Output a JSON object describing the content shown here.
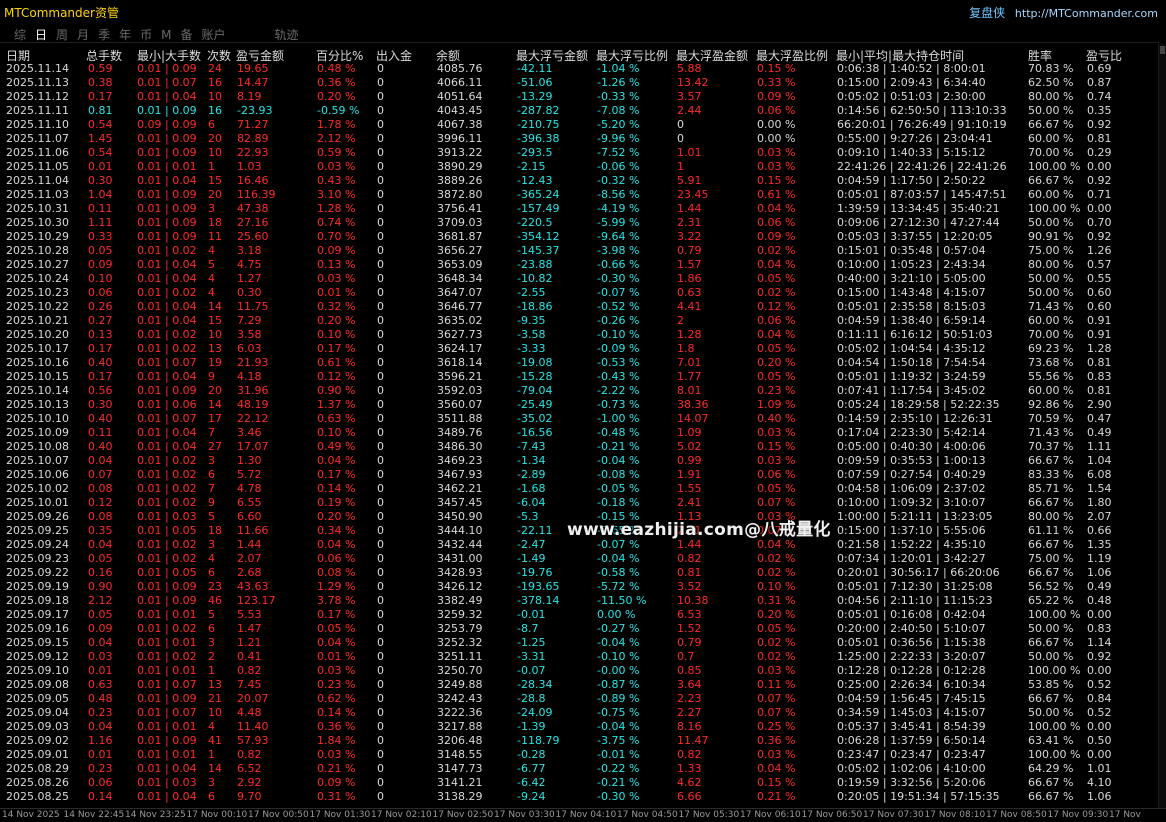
{
  "app": {
    "title": "MTCommander资管",
    "copy_label": "复盘侠",
    "url": "http://MTCommander.com"
  },
  "tabs": [
    "综",
    "日",
    "周",
    "月",
    "季",
    "年",
    "币",
    "M",
    "备",
    "账户",
    "轨迹"
  ],
  "active_tab": "日",
  "headers": {
    "date": "日期",
    "total_lots": "总手数",
    "lot_range": "最小|大手数",
    "count": "次数",
    "pnl": "盈亏金额",
    "pct": "百分比%",
    "deposit": "出入金",
    "balance": "余额",
    "max_float_loss": "最大浮亏金额",
    "max_float_loss_pct": "最大浮亏比例",
    "max_float_profit": "最大浮盈金额",
    "max_float_profit_pct": "最大浮盈比例",
    "hold_time": "最小|平均|最大持仓时间",
    "win_rate": "胜率",
    "pl_ratio": "盈亏比"
  },
  "rows": [
    [
      "2025.11.14",
      "0.59",
      "0.01 | 0.09",
      "24",
      "19.65",
      "0.48 %",
      "0",
      "4085.76",
      "-42.11",
      "-1.04 %",
      "5.88",
      "0.15 %",
      "0:06:38 | 1:40:52 | 8:00:01",
      "70.83 %",
      "0.69"
    ],
    [
      "2025.11.13",
      "0.38",
      "0.01 | 0.07",
      "16",
      "14.47",
      "0.36 %",
      "0",
      "4066.11",
      "-51.06",
      "-1.26 %",
      "13.42",
      "0.33 %",
      "0:15:00 | 2:09:43 | 6:34:40",
      "62.50 %",
      "0.87"
    ],
    [
      "2025.11.12",
      "0.17",
      "0.01 | 0.04",
      "10",
      "8.19",
      "0.20 %",
      "0",
      "4051.64",
      "-13.29",
      "-0.33 %",
      "3.57",
      "0.09 %",
      "0:05:02 | 0:51:03 | 2:30:00",
      "80.00 %",
      "0.74"
    ],
    [
      "2025.11.11",
      "0.81",
      "0.01 | 0.09",
      "16",
      "-23.93",
      "-0.59 %",
      "0",
      "4043.45",
      "-287.82",
      "-7.08 %",
      "2.44",
      "0.06 %",
      "0:14:56 | 62:50:50 | 113:10:33",
      "50.00 %",
      "0.35"
    ],
    [
      "2025.11.10",
      "0.54",
      "0.09 | 0.09",
      "6",
      "71.27",
      "1.78 %",
      "0",
      "4067.38",
      "-210.75",
      "-5.20 %",
      "0",
      "0.00 %",
      "66:20:01 | 76:26:49 | 91:10:19",
      "66.67 %",
      "0.92"
    ],
    [
      "2025.11.07",
      "1.45",
      "0.01 | 0.09",
      "20",
      "82.89",
      "2.12 %",
      "0",
      "3996.11",
      "-396.38",
      "-9.96 %",
      "0",
      "0.00 %",
      "0:55:00 | 9:27:26 | 23:04:41",
      "60.00 %",
      "0.81"
    ],
    [
      "2025.11.06",
      "0.54",
      "0.01 | 0.09",
      "10",
      "22.93",
      "0.59 %",
      "0",
      "3913.22",
      "-293.5",
      "-7.52 %",
      "1.01",
      "0.03 %",
      "0:09:10 | 1:40:33 | 5:15:12",
      "70.00 %",
      "0.29"
    ],
    [
      "2025.11.05",
      "0.01",
      "0.01 | 0.01",
      "1",
      "1.03",
      "0.03 %",
      "0",
      "3890.29",
      "-2.15",
      "-0.06 %",
      "1",
      "0.03 %",
      "22:41:26 | 22:41:26 | 22:41:26",
      "100.00 %",
      "0.00"
    ],
    [
      "2025.11.04",
      "0.30",
      "0.01 | 0.04",
      "15",
      "16.46",
      "0.43 %",
      "0",
      "3889.26",
      "-12.43",
      "-0.32 %",
      "5.91",
      "0.15 %",
      "0:04:59 | 1:17:50 | 2:50:22",
      "66.67 %",
      "0.92"
    ],
    [
      "2025.11.03",
      "1.04",
      "0.01 | 0.09",
      "20",
      "116.39",
      "3.10 %",
      "0",
      "3872.80",
      "-365.24",
      "-8.56 %",
      "23.45",
      "0.61 %",
      "0:05:01 | 87:03:57 | 145:47:51",
      "60.00 %",
      "0.71"
    ],
    [
      "2025.10.31",
      "0.11",
      "0.01 | 0.09",
      "3",
      "47.38",
      "1.28 %",
      "0",
      "3756.41",
      "-157.49",
      "-4.19 %",
      "1.44",
      "0.04 %",
      "1:39:59 | 13:34:45 | 35:40:21",
      "100.00 %",
      "0.00"
    ],
    [
      "2025.10.30",
      "1.11",
      "0.01 | 0.09",
      "18",
      "27.16",
      "0.74 %",
      "0",
      "3709.03",
      "-220.5",
      "-5.99 %",
      "2.31",
      "0.06 %",
      "0:09:06 | 27:12:30 | 47:27:44",
      "50.00 %",
      "0.70"
    ],
    [
      "2025.10.29",
      "0.33",
      "0.01 | 0.09",
      "11",
      "25.60",
      "0.70 %",
      "0",
      "3681.87",
      "-354.12",
      "-9.64 %",
      "3.22",
      "0.09 %",
      "0:05:03 | 3:37:55 | 12:20:05",
      "90.91 %",
      "0.92"
    ],
    [
      "2025.10.28",
      "0.05",
      "0.01 | 0.02",
      "4",
      "3.18",
      "0.09 %",
      "0",
      "3656.27",
      "-145.37",
      "-3.98 %",
      "0.79",
      "0.02 %",
      "0:15:01 | 0:35:48 | 0:57:04",
      "75.00 %",
      "1.26"
    ],
    [
      "2025.10.27",
      "0.09",
      "0.01 | 0.04",
      "5",
      "4.75",
      "0.13 %",
      "0",
      "3653.09",
      "-23.88",
      "-0.66 %",
      "1.57",
      "0.04 %",
      "0:10:00 | 1:05:23 | 2:43:34",
      "80.00 %",
      "0.57"
    ],
    [
      "2025.10.24",
      "0.10",
      "0.01 | 0.04",
      "4",
      "1.27",
      "0.03 %",
      "0",
      "3648.34",
      "-10.82",
      "-0.30 %",
      "1.86",
      "0.05 %",
      "0:40:00 | 3:21:10 | 5:05:00",
      "50.00 %",
      "0.55"
    ],
    [
      "2025.10.23",
      "0.06",
      "0.01 | 0.02",
      "4",
      "0.30",
      "0.01 %",
      "0",
      "3647.07",
      "-2.55",
      "-0.07 %",
      "0.63",
      "0.02 %",
      "0:15:00 | 1:43:48 | 4:15:07",
      "50.00 %",
      "0.60"
    ],
    [
      "2025.10.22",
      "0.26",
      "0.01 | 0.04",
      "14",
      "11.75",
      "0.32 %",
      "0",
      "3646.77",
      "-18.86",
      "-0.52 %",
      "4.41",
      "0.12 %",
      "0:05:01 | 2:35:58 | 8:15:03",
      "71.43 %",
      "0.60"
    ],
    [
      "2025.10.21",
      "0.27",
      "0.01 | 0.04",
      "15",
      "7.29",
      "0.20 %",
      "0",
      "3635.02",
      "-9.35",
      "-0.26 %",
      "2",
      "0.06 %",
      "0:04:59 | 1:38:40 | 6:59:14",
      "60.00 %",
      "0.91"
    ],
    [
      "2025.10.20",
      "0.13",
      "0.01 | 0.02",
      "10",
      "3.58",
      "0.10 %",
      "0",
      "3627.73",
      "-3.58",
      "-0.10 %",
      "1.28",
      "0.04 %",
      "0:11:11 | 6:16:12 | 50:51:03",
      "70.00 %",
      "0.91"
    ],
    [
      "2025.10.17",
      "0.17",
      "0.01 | 0.02",
      "13",
      "6.03",
      "0.17 %",
      "0",
      "3624.17",
      "-3.33",
      "-0.09 %",
      "1.8",
      "0.05 %",
      "0:05:02 | 1:04:54 | 4:35:12",
      "69.23 %",
      "1.28"
    ],
    [
      "2025.10.16",
      "0.40",
      "0.01 | 0.07",
      "19",
      "21.93",
      "0.61 %",
      "0",
      "3618.14",
      "-19.08",
      "-0.53 %",
      "7.01",
      "0.20 %",
      "0:04:54 | 1:50:18 | 7:54:54",
      "73.68 %",
      "0.81"
    ],
    [
      "2025.10.15",
      "0.17",
      "0.01 | 0.04",
      "9",
      "4.18",
      "0.12 %",
      "0",
      "3596.21",
      "-15.28",
      "-0.43 %",
      "1.77",
      "0.05 %",
      "0:05:01 | 1:19:32 | 3:24:59",
      "55.56 %",
      "0.83"
    ],
    [
      "2025.10.14",
      "0.56",
      "0.01 | 0.09",
      "20",
      "31.96",
      "0.90 %",
      "0",
      "3592.03",
      "-79.04",
      "-2.22 %",
      "8.01",
      "0.23 %",
      "0:07:41 | 1:17:54 | 3:45:02",
      "60.00 %",
      "0.81"
    ],
    [
      "2025.10.13",
      "0.30",
      "0.01 | 0.06",
      "14",
      "48.19",
      "1.37 %",
      "0",
      "3560.07",
      "-25.49",
      "-0.73 %",
      "38.36",
      "1.09 %",
      "0:05:24 | 18:29:58 | 52:22:35",
      "92.86 %",
      "2.90"
    ],
    [
      "2025.10.10",
      "0.40",
      "0.01 | 0.07",
      "17",
      "22.12",
      "0.63 %",
      "0",
      "3511.88",
      "-35.02",
      "-1.00 %",
      "14.07",
      "0.40 %",
      "0:14:59 | 2:35:10 | 12:26:31",
      "70.59 %",
      "0.47"
    ],
    [
      "2025.10.09",
      "0.11",
      "0.01 | 0.04",
      "7",
      "3.46",
      "0.10 %",
      "0",
      "3489.76",
      "-16.56",
      "-0.48 %",
      "1.09",
      "0.03 %",
      "0:17:04 | 2:23:30 | 5:42:14",
      "71.43 %",
      "0.49"
    ],
    [
      "2025.10.08",
      "0.40",
      "0.01 | 0.04",
      "27",
      "17.07",
      "0.49 %",
      "0",
      "3486.30",
      "-7.43",
      "-0.21 %",
      "5.02",
      "0.15 %",
      "0:05:00 | 0:40:30 | 4:00:06",
      "70.37 %",
      "1.11"
    ],
    [
      "2025.10.07",
      "0.04",
      "0.01 | 0.02",
      "3",
      "1.30",
      "0.04 %",
      "0",
      "3469.23",
      "-1.34",
      "-0.04 %",
      "0.99",
      "0.03 %",
      "0:09:59 | 0:35:53 | 1:00:13",
      "66.67 %",
      "1.04"
    ],
    [
      "2025.10.06",
      "0.07",
      "0.01 | 0.02",
      "6",
      "5.72",
      "0.17 %",
      "0",
      "3467.93",
      "-2.89",
      "-0.08 %",
      "1.91",
      "0.06 %",
      "0:07:59 | 0:27:54 | 0:40:29",
      "83.33 %",
      "6.08"
    ],
    [
      "2025.10.02",
      "0.08",
      "0.01 | 0.02",
      "7",
      "4.78",
      "0.14 %",
      "0",
      "3462.21",
      "-1.68",
      "-0.05 %",
      "1.55",
      "0.05 %",
      "0:04:58 | 1:06:09 | 2:37:02",
      "85.71 %",
      "1.54"
    ],
    [
      "2025.10.01",
      "0.12",
      "0.01 | 0.02",
      "9",
      "6.55",
      "0.19 %",
      "0",
      "3457.45",
      "-6.04",
      "-0.18 %",
      "2.41",
      "0.07 %",
      "0:10:00 | 1:09:32 | 3:10:07",
      "66.67 %",
      "1.80"
    ],
    [
      "2025.09.26",
      "0.08",
      "0.01 | 0.03",
      "5",
      "6.60",
      "0.20 %",
      "0",
      "3450.90",
      "-5.3",
      "-0.15 %",
      "1.13",
      "0.03 %",
      "1:00:00 | 5:21:11 | 13:23:05",
      "80.00 %",
      "2.07"
    ],
    [
      "2025.09.25",
      "0.35",
      "0.01 | 0.05",
      "18",
      "11.66",
      "0.34 %",
      "0",
      "3444.10",
      "-22.11",
      "-0.65 %",
      "2.41",
      "0.07 %",
      "0:15:00 | 1:37:10 | 5:55:06",
      "61.11 %",
      "0.66"
    ],
    [
      "2025.09.24",
      "0.04",
      "0.01 | 0.02",
      "3",
      "1.44",
      "0.04 %",
      "0",
      "3432.44",
      "-2.47",
      "-0.07 %",
      "1.44",
      "0.04 %",
      "0:21:58 | 1:52:22 | 4:35:10",
      "66.67 %",
      "1.35"
    ],
    [
      "2025.09.23",
      "0.05",
      "0.01 | 0.02",
      "4",
      "2.07",
      "0.06 %",
      "0",
      "3431.00",
      "-1.49",
      "-0.04 %",
      "0.82",
      "0.02 %",
      "0:07:34 | 1:20:01 | 3:42:27",
      "75.00 %",
      "1.19"
    ],
    [
      "2025.09.22",
      "0.16",
      "0.01 | 0.05",
      "6",
      "2.68",
      "0.08 %",
      "0",
      "3428.93",
      "-19.76",
      "-0.58 %",
      "0.81",
      "0.02 %",
      "0:20:01 | 30:56:17 | 66:20:06",
      "66.67 %",
      "1.06"
    ],
    [
      "2025.09.19",
      "0.90",
      "0.01 | 0.09",
      "23",
      "43.63",
      "1.29 %",
      "0",
      "3426.12",
      "-193.65",
      "-5.72 %",
      "3.52",
      "0.10 %",
      "0:05:01 | 7:12:30 | 31:25:08",
      "56.52 %",
      "0.49"
    ],
    [
      "2025.09.18",
      "2.12",
      "0.01 | 0.09",
      "46",
      "123.17",
      "3.78 %",
      "0",
      "3382.49",
      "-378.14",
      "-11.50 %",
      "10.38",
      "0.31 %",
      "0:04:56 | 2:11:10 | 11:15:23",
      "65.22 %",
      "0.48"
    ],
    [
      "2025.09.17",
      "0.05",
      "0.01 | 0.01",
      "5",
      "5.53",
      "0.17 %",
      "0",
      "3259.32",
      "-0.01",
      "0.00 %",
      "6.53",
      "0.20 %",
      "0:05:01 | 0:16:08 | 0:42:04",
      "100.00 %",
      "0.00"
    ],
    [
      "2025.09.16",
      "0.09",
      "0.01 | 0.02",
      "6",
      "1.47",
      "0.05 %",
      "0",
      "3253.79",
      "-8.7",
      "-0.27 %",
      "1.52",
      "0.05 %",
      "0:20:00 | 2:40:50 | 5:10:07",
      "50.00 %",
      "0.83"
    ],
    [
      "2025.09.15",
      "0.04",
      "0.01 | 0.01",
      "3",
      "1.21",
      "0.04 %",
      "0",
      "3252.32",
      "-1.25",
      "-0.04 %",
      "0.79",
      "0.02 %",
      "0:05:01 | 0:36:56 | 1:15:38",
      "66.67 %",
      "1.14"
    ],
    [
      "2025.09.12",
      "0.03",
      "0.01 | 0.02",
      "2",
      "0.41",
      "0.01 %",
      "0",
      "3251.11",
      "-3.31",
      "-0.10 %",
      "0.7",
      "0.02 %",
      "1:25:00 | 2:22:33 | 3:20:07",
      "50.00 %",
      "0.92"
    ],
    [
      "2025.09.10",
      "0.01",
      "0.01 | 0.01",
      "1",
      "0.82",
      "0.03 %",
      "0",
      "3250.70",
      "-0.07",
      "-0.00 %",
      "0.85",
      "0.03 %",
      "0:12:28 | 0:12:28 | 0:12:28",
      "100.00 %",
      "0.00"
    ],
    [
      "2025.09.08",
      "0.63",
      "0.01 | 0.07",
      "13",
      "7.45",
      "0.23 %",
      "0",
      "3249.88",
      "-28.34",
      "-0.87 %",
      "3.64",
      "0.11 %",
      "0:25:00 | 2:26:34 | 6:10:34",
      "53.85 %",
      "0.52"
    ],
    [
      "2025.09.05",
      "0.48",
      "0.01 | 0.09",
      "21",
      "20.07",
      "0.62 %",
      "0",
      "3242.43",
      "-28.8",
      "-0.89 %",
      "2.23",
      "0.07 %",
      "0:04:59 | 1:56:45 | 7:45:15",
      "66.67 %",
      "0.84"
    ],
    [
      "2025.09.04",
      "0.23",
      "0.01 | 0.07",
      "10",
      "4.48",
      "0.14 %",
      "0",
      "3222.36",
      "-24.09",
      "-0.75 %",
      "2.27",
      "0.07 %",
      "0:34:59 | 1:45:03 | 4:15:07",
      "50.00 %",
      "0.52"
    ],
    [
      "2025.09.03",
      "0.04",
      "0.01 | 0.01",
      "4",
      "11.40",
      "0.36 %",
      "0",
      "3217.88",
      "-1.39",
      "-0.04 %",
      "8.16",
      "0.25 %",
      "0:05:37 | 3:45:41 | 8:54:39",
      "100.00 %",
      "0.00"
    ],
    [
      "2025.09.02",
      "1.16",
      "0.01 | 0.09",
      "41",
      "57.93",
      "1.84 %",
      "0",
      "3206.48",
      "-118.79",
      "-3.75 %",
      "11.47",
      "0.36 %",
      "0:06:28 | 1:37:59 | 6:50:14",
      "63.41 %",
      "0.50"
    ],
    [
      "2025.09.01",
      "0.01",
      "0.01 | 0.01",
      "1",
      "0.82",
      "0.03 %",
      "0",
      "3148.55",
      "-0.28",
      "-0.01 %",
      "0.82",
      "0.03 %",
      "0:23:47 | 0:23:47 | 0:23:47",
      "100.00 %",
      "0.00"
    ],
    [
      "2025.08.29",
      "0.23",
      "0.01 | 0.04",
      "14",
      "6.52",
      "0.21 %",
      "0",
      "3147.73",
      "-6.77",
      "-0.22 %",
      "1.33",
      "0.04 %",
      "0:05:02 | 1:02:06 | 4:10:00",
      "64.29 %",
      "1.01"
    ],
    [
      "2025.08.26",
      "0.06",
      "0.01 | 0.03",
      "3",
      "2.92",
      "0.09 %",
      "0",
      "3141.21",
      "-6.42",
      "-0.21 %",
      "4.62",
      "0.15 %",
      "0:19:59 | 3:32:56 | 5:20:06",
      "66.67 %",
      "4.10"
    ],
    [
      "2025.08.25",
      "0.14",
      "0.01 | 0.04",
      "6",
      "9.70",
      "0.31 %",
      "0",
      "3138.29",
      "-9.24",
      "-0.30 %",
      "6.66",
      "0.21 %",
      "0:20:05 | 19:51:34 | 57:15:35",
      "66.67 %",
      "1.06"
    ]
  ],
  "watermark": "www.eazhijia.com@八戒量化",
  "time_axis": [
    "14 Nov 2025",
    "14 Nov 22:45",
    "14 Nov 23:25",
    "17 Nov 00:10",
    "17 Nov 00:50",
    "17 Nov 01:30",
    "17 Nov 02:10",
    "17 Nov 02:50",
    "17 Nov 03:30",
    "17 Nov 04:10",
    "17 Nov 04:50",
    "17 Nov 05:30",
    "17 Nov 06:10",
    "17 Nov 06:50",
    "17 Nov 07:30",
    "17 Nov 08:10",
    "17 Nov 08:50",
    "17 Nov 09:30",
    "17 Nov"
  ],
  "colors": {
    "title": "#ffd400",
    "profit": "#ff2a2a",
    "loss": "#24e6e6",
    "text": "#d8d8d8",
    "background": "#000000",
    "link": "#6fc3ff"
  }
}
